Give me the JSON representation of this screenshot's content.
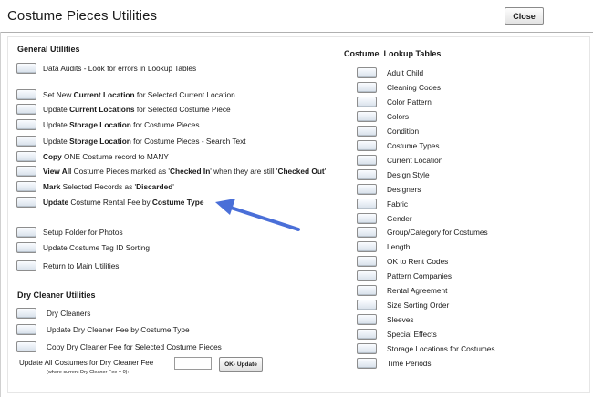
{
  "window": {
    "title": "Costume Pieces Utilities",
    "close_label": "Close"
  },
  "general": {
    "title": "General Utilities",
    "items": [
      [
        "Data Audits - Look for errors in Lookup Tables"
      ],
      [
        "Set New ",
        "Current Location",
        " for Selected Current Location"
      ],
      [
        "Update ",
        "Current Locations",
        " for Selected Costume Piece"
      ],
      [
        "Update ",
        "Storage Location",
        " for Costume Pieces"
      ],
      [
        "Update ",
        "Storage Location",
        " for Costume Pieces - Search Text"
      ],
      [
        "Copy",
        " ONE Costume record to MANY"
      ],
      [
        "View All",
        " Costume Pieces marked as '",
        "Checked In",
        "' when they are still '",
        "Checked Out",
        "'"
      ],
      [
        "Mark",
        " Selected Records as '",
        "Discarded",
        "'"
      ],
      [
        "Update",
        " Costume Rental Fee by ",
        "Costume Type"
      ],
      [
        "Setup Folder for Photos"
      ],
      [
        "Update Costume Tag ID Sorting"
      ],
      [
        "Return to Main Utilities"
      ]
    ]
  },
  "dry_cleaner": {
    "title": "Dry Cleaner Utilities",
    "items": [
      "Dry Cleaners",
      "Update Dry Cleaner Fee by Costume Type",
      "Copy Dry Cleaner Fee for Selected Costume Pieces"
    ],
    "update_all_label": "Update All Costumes for Dry Cleaner Fee",
    "update_all_note": "(where current Dry Cleaner Fee = 0):",
    "fee_value": "",
    "ok_label": "OK- Update"
  },
  "lookup": {
    "title": "Costume  Lookup Tables",
    "items": [
      "Adult Child",
      "Cleaning Codes",
      "Color Pattern",
      "Colors",
      "Condition",
      "Costume Types",
      "Current Location",
      "Design Style",
      "Designers",
      "Fabric",
      "Gender",
      "Group/Category for Costumes",
      "Length",
      "OK to Rent Codes",
      "Pattern Companies",
      "Rental Agreement",
      "Size Sorting Order",
      "Sleeves",
      "Special Effects",
      "Storage Locations for Costumes",
      "Time Periods"
    ]
  },
  "annotation": {
    "arrow_color": "#4a6fd8",
    "arrow_target": "Update Costume Rental Fee by Costume Type"
  }
}
